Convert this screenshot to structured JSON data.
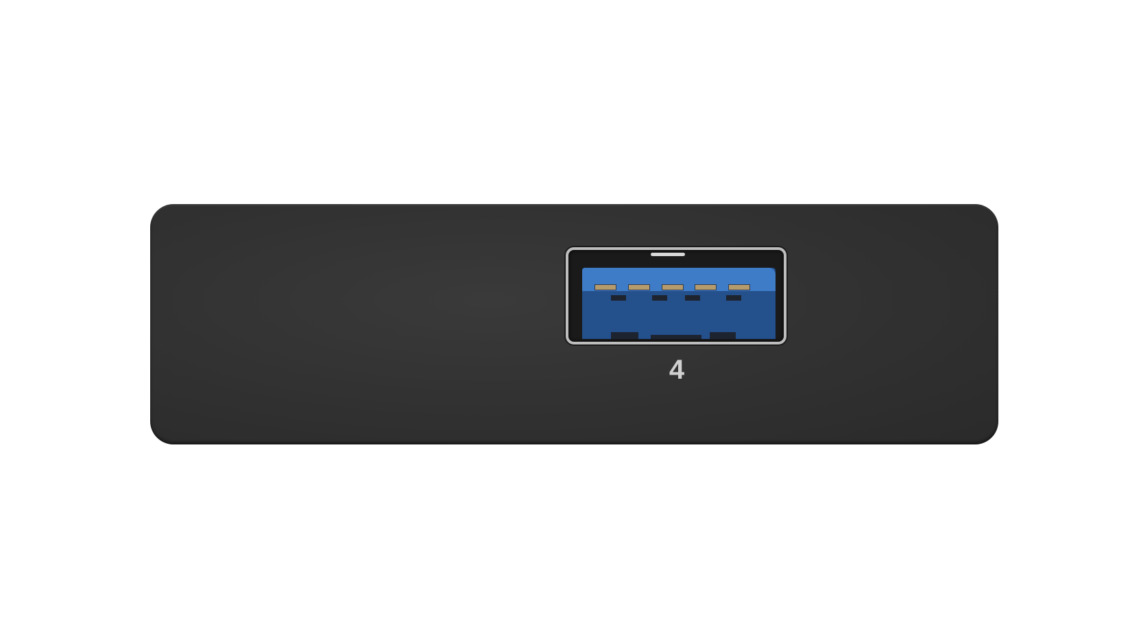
{
  "device": {
    "port_number_label": "4",
    "port_type": "usb-3-type-a",
    "colors": {
      "body": "#303030",
      "port_insert": "#3f7cc8"
    }
  }
}
